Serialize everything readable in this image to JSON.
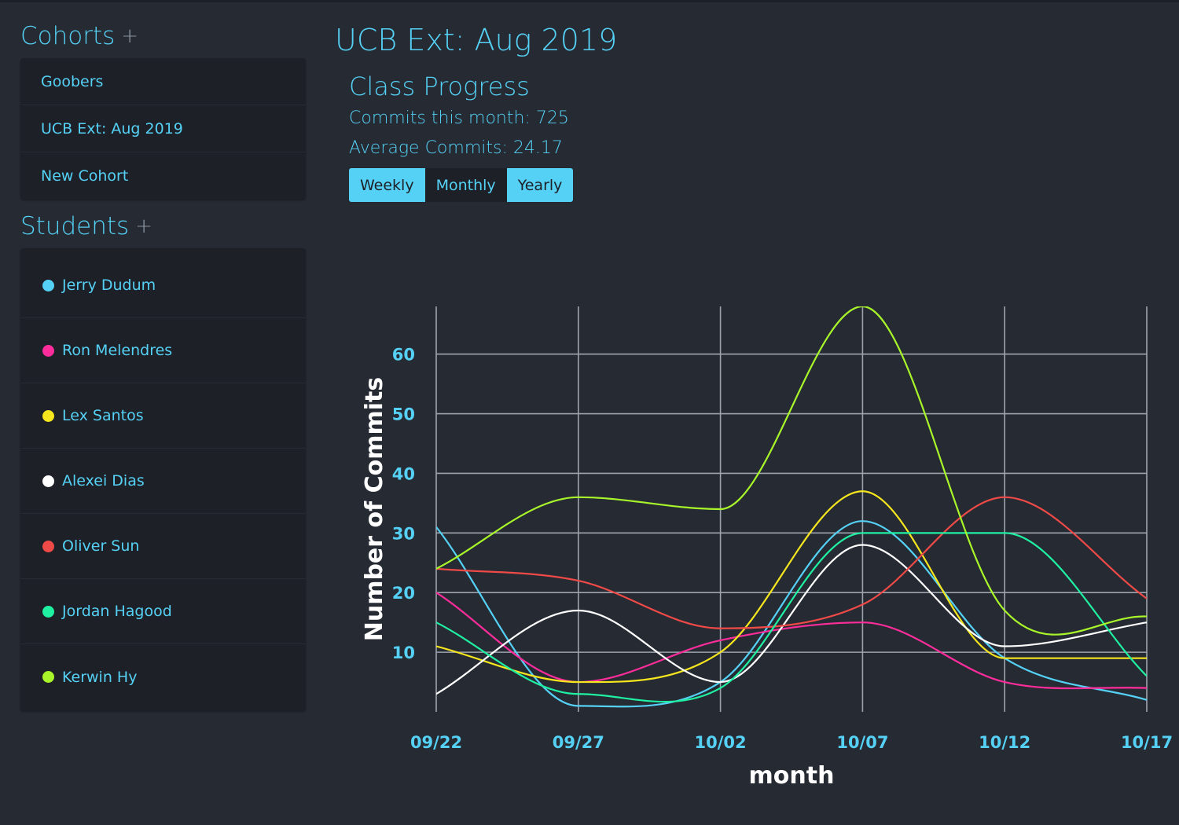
{
  "sidebar": {
    "cohorts_title": "Cohorts",
    "cohorts_add": "+",
    "cohorts": [
      "Goobers",
      "UCB Ext: Aug 2019",
      "New Cohort"
    ],
    "students_title": "Students",
    "students_add": "+",
    "students": [
      {
        "name": "Jerry Dudum",
        "color": "#55d1f5"
      },
      {
        "name": "Ron Melendres",
        "color": "#ff2d9b"
      },
      {
        "name": "Lex Santos",
        "color": "#f5e61e"
      },
      {
        "name": "Alexei Dias",
        "color": "#ffffff"
      },
      {
        "name": "Oliver Sun",
        "color": "#ef4a47"
      },
      {
        "name": "Jordan Hagood",
        "color": "#1ff0a2"
      },
      {
        "name": "Kerwin Hy",
        "color": "#a8f52a"
      }
    ]
  },
  "main": {
    "cohort_title": "UCB Ext: Aug 2019",
    "progress_title": "Class Progress",
    "commits_this_month": "Commits this month: 725",
    "average_commits": "Average Commits: 24.17",
    "buttons": [
      {
        "label": "Weekly",
        "active": true
      },
      {
        "label": "Monthly",
        "active": false
      },
      {
        "label": "Yearly",
        "active": true
      }
    ]
  },
  "chart_data": {
    "type": "line",
    "x": [
      "09/22",
      "09/27",
      "10/02",
      "10/07",
      "10/12",
      "10/17"
    ],
    "xlabel": "month",
    "ylabel": "Number of Commits",
    "yticks": [
      10,
      20,
      30,
      40,
      50,
      60
    ],
    "ylim": [
      0,
      68
    ],
    "grid": true,
    "series": [
      {
        "name": "Jerry Dudum",
        "color": "#55d1f5",
        "values": [
          31,
          1,
          5,
          32,
          9,
          2
        ]
      },
      {
        "name": "Ron Melendres",
        "color": "#ff2d9b",
        "values": [
          20,
          5,
          12,
          15,
          5,
          4
        ]
      },
      {
        "name": "Lex Santos",
        "color": "#f5e61e",
        "values": [
          11,
          5,
          10,
          37,
          9,
          9
        ]
      },
      {
        "name": "Alexei Dias",
        "color": "#ffffff",
        "values": [
          3,
          17,
          5,
          28,
          11,
          15
        ]
      },
      {
        "name": "Oliver Sun",
        "color": "#ef4a47",
        "values": [
          24,
          22,
          14,
          18,
          36,
          19
        ]
      },
      {
        "name": "Jordan Hagood",
        "color": "#1ff0a2",
        "values": [
          15,
          3,
          4,
          30,
          30,
          6
        ]
      },
      {
        "name": "Kerwin Hy",
        "color": "#a8f52a",
        "values": [
          24,
          36,
          34,
          68,
          17,
          16
        ]
      }
    ]
  }
}
